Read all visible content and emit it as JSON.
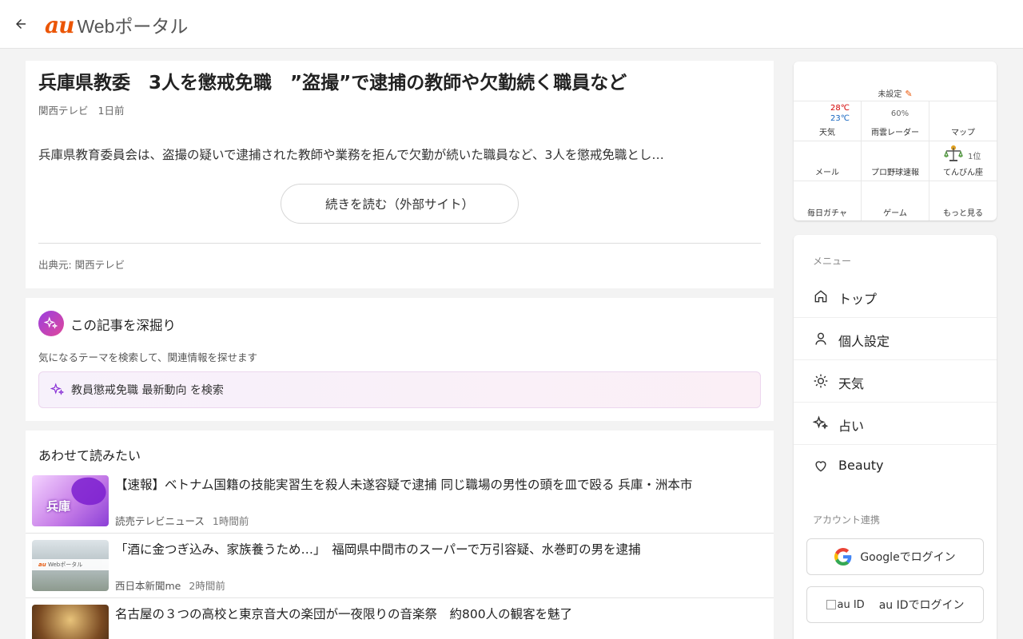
{
  "header": {
    "logo_au": "au",
    "logo_rest": "Webポータル"
  },
  "article": {
    "title": "兵庫県教委　3人を懲戒免職　”盗撮”で逮捕の教師や欠勤続く職員など",
    "source_name": "関西テレビ",
    "time": "1日前",
    "lead": "兵庫県教育委員会は、盗撮の疑いで逮捕された教師や業務を拒んで欠勤が続いた職員など、3人を懲戒免職とし…",
    "read_more": "続きを読む（外部サイト）",
    "source_line": "出典元: 関西テレビ"
  },
  "deep_dive": {
    "title": "この記事を深掘り",
    "subtitle": "気になるテーマを検索して、関連情報を探せます",
    "search_text": "教員懲戒免職 最新動向 を検索"
  },
  "related": {
    "title": "あわせて読みたい",
    "items": [
      {
        "headline": "【速報】ベトナム国籍の技能実習生を殺人未遂容疑で逮捕 同じ職場の男性の頭を皿で殴る 兵庫・洲本市",
        "source": "読売テレビニュース",
        "time": "1時間前",
        "thumb_text": "兵庫"
      },
      {
        "headline": "「酒に金つぎ込み、家族養うため…」　福岡県中間市のスーパーで万引容疑、水巻町の男を逮捕",
        "source": "西日本新聞me",
        "time": "2時間前",
        "thumb_text": "Webポータル"
      },
      {
        "headline": "名古屋の３つの高校と東京音大の楽団が一夜限りの音楽祭　約800人の観客を魅了",
        "source": "",
        "time": ""
      }
    ]
  },
  "widget": {
    "location": "未設定",
    "weather": {
      "high": "28℃",
      "low": "23℃",
      "label": "天気"
    },
    "rain_radar": {
      "percent": "60%",
      "label": "雨雲レーダー"
    },
    "map": {
      "label": "マップ"
    },
    "mail": {
      "label": "メール"
    },
    "baseball": {
      "label": "プロ野球速報"
    },
    "horoscope": {
      "rank": "1位",
      "label": "てんびん座"
    },
    "gacha": {
      "label": "毎日ガチャ"
    },
    "game": {
      "label": "ゲーム"
    },
    "more": {
      "label": "もっと見る"
    }
  },
  "menu": {
    "caption": "メニュー",
    "items": [
      {
        "label": "トップ",
        "icon": "home-icon"
      },
      {
        "label": "個人設定",
        "icon": "person-icon"
      },
      {
        "label": "天気",
        "icon": "sun-icon"
      },
      {
        "label": "占い",
        "icon": "sparkle-icon"
      },
      {
        "label": "Beauty",
        "icon": "heart-icon"
      }
    ],
    "account_caption": "アカウント連携",
    "google_login": "Googleでログイン",
    "auid_alt": "au ID",
    "auid_login": "au IDでログイン"
  },
  "colors": {
    "brand": "#eb5505",
    "temp_high": "#d20000",
    "temp_low": "#1565c0",
    "deep_dive_gradient_start": "#9a3fe0",
    "deep_dive_gradient_end": "#e0479a"
  }
}
